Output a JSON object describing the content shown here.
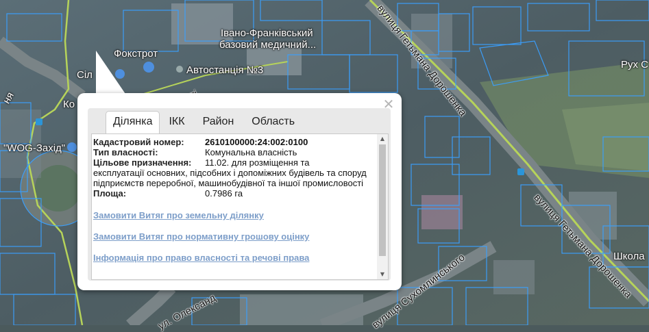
{
  "map": {
    "labels": {
      "fokstrot": "Фокстрот",
      "clinic_line1": "Івано-Франківський",
      "clinic_line2": "базовий медичний...",
      "bus_station": "Автостанція №3",
      "silpo_partial": "Сіл",
      "ko_partial": "Ко",
      "nya_partial": "ня",
      "wog": "\"WOG-Захід\"",
      "rukh_partial": "Рух С",
      "shkola_partial": "Школа"
    },
    "streets": {
      "doroshenka_top": "вулиця Гетьмана Дорошенка",
      "doroshenka_bottom": "вулиця Гетьмана Дорошенка",
      "sukhomlynskoho": "вулиця Сухомлинського",
      "oleksandra": "ул. Олександ",
      "left_partial": "ті"
    }
  },
  "popup": {
    "close_icon": "close-icon",
    "tabs": [
      "Ділянка",
      "ІКК",
      "Район",
      "Область"
    ],
    "active_tab": 0,
    "fields": {
      "cadastral_label": "Кадастровий номер:",
      "cadastral_value": "2610100000:24:002:0100",
      "ownership_label": "Тип власності:",
      "ownership_value": "Комунальна власність",
      "purpose_label": "Цільове призначення:",
      "purpose_value_first": "11.02. для розміщення та",
      "purpose_value_rest": "експлуатації основних, підсобних і допоміжних будівель та споруд підприємств переробної, машинобудівної та іншої промисловості",
      "area_label": "Площа:",
      "area_value": "0.7986 га"
    },
    "links": [
      "Замовити Витяг про земельну ділянку",
      "Замовити Витяг про нормативну грошову оцінку",
      "Інформація про право власності та речові права"
    ]
  }
}
